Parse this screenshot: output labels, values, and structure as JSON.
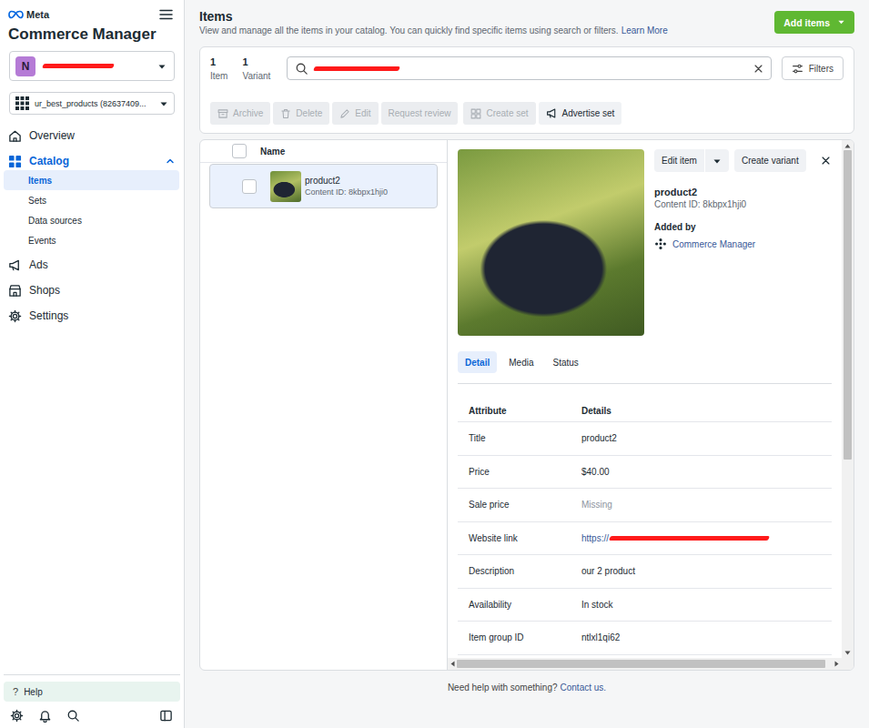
{
  "sidebar": {
    "brand": "Meta",
    "title": "Commerce Manager",
    "business": {
      "avatar": "N",
      "redacted": true
    },
    "catalog": {
      "label": "ur_best_products (82637409..."
    },
    "nav": [
      {
        "label": "Overview",
        "selected": false,
        "expanded": false,
        "children": []
      },
      {
        "label": "Catalog",
        "selected": false,
        "expanded": true,
        "children": [
          {
            "label": "Items",
            "selected": true
          },
          {
            "label": "Sets",
            "selected": false
          },
          {
            "label": "Data sources",
            "selected": false
          },
          {
            "label": "Events",
            "selected": false
          }
        ]
      },
      {
        "label": "Ads",
        "selected": false,
        "expanded": false,
        "children": []
      },
      {
        "label": "Shops",
        "selected": false,
        "expanded": false,
        "children": []
      },
      {
        "label": "Settings",
        "selected": false,
        "expanded": false,
        "children": []
      }
    ],
    "help": {
      "icon": "?",
      "label": "Help"
    }
  },
  "header": {
    "title": "Items",
    "subtitle": "View and manage all the items in your catalog. You can quickly find specific items using search or filters.",
    "learn_more": "Learn More",
    "add_button": "Add items"
  },
  "counts": [
    {
      "value": "1",
      "label": "Item"
    },
    {
      "value": "1",
      "label": "Variant"
    }
  ],
  "search": {
    "redacted": true
  },
  "filters": "Filters",
  "toolbar": {
    "groups": [
      {
        "buttons": [
          {
            "label": "Archive",
            "disabled": true
          },
          {
            "label": "Delete",
            "disabled": true
          },
          {
            "label": "Edit",
            "disabled": true
          },
          {
            "label": "Request review",
            "disabled": true
          }
        ]
      },
      {
        "buttons": [
          {
            "label": "Create set",
            "disabled": true
          },
          {
            "label": "Advertise set",
            "disabled": false
          }
        ]
      }
    ]
  },
  "list": {
    "header": "Name",
    "all_checked": false,
    "rows": [
      {
        "name": "product2",
        "content_id": "Content ID: 8kbpx1hji0",
        "selected": true,
        "checked": false
      }
    ]
  },
  "detail": {
    "edit_button": "Edit item",
    "create_variant": "Create variant",
    "title": "product2",
    "content_id": "Content ID: 8kbpx1hji0",
    "added_by_label": "Added by",
    "added_by": "Commerce Manager",
    "tabs": [
      {
        "label": "Detail",
        "selected": true
      },
      {
        "label": "Media",
        "selected": false
      },
      {
        "label": "Status",
        "selected": false
      }
    ],
    "table": {
      "columns": [
        "Attribute",
        "Details"
      ],
      "rows": [
        {
          "attribute": "Title",
          "value": "product2",
          "kind": "text"
        },
        {
          "attribute": "Price",
          "value": "$40.00",
          "kind": "text"
        },
        {
          "attribute": "Sale price",
          "value": "Missing",
          "kind": "missing"
        },
        {
          "attribute": "Website link",
          "value": "https://",
          "kind": "link",
          "redacted": true
        },
        {
          "attribute": "Description",
          "value": "our 2 product",
          "kind": "text"
        },
        {
          "attribute": "Availability",
          "value": "In stock",
          "kind": "text"
        },
        {
          "attribute": "Item group ID",
          "value": "ntlxl1qi62",
          "kind": "text"
        }
      ]
    },
    "scroll": {
      "vertical_level": 0.62,
      "horizontal_level": 0.98
    }
  },
  "footer": {
    "text": "Need help with something?",
    "link": "Contact us."
  }
}
